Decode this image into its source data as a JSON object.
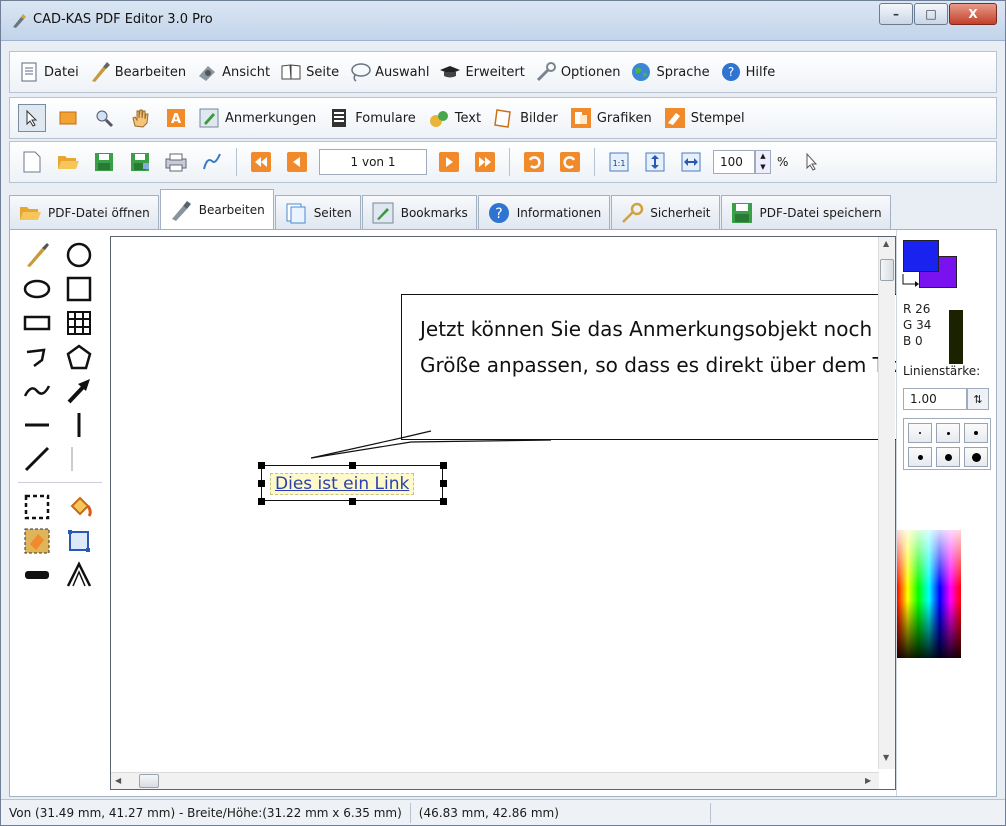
{
  "window": {
    "title": "CAD-KAS PDF Editor 3.0 Pro",
    "minimize": "–",
    "maximize": "□",
    "close": "X"
  },
  "menu": [
    {
      "label": "Datei",
      "icon": "document-icon"
    },
    {
      "label": "Bearbeiten",
      "icon": "brush-icon"
    },
    {
      "label": "Ansicht",
      "icon": "eye-icon"
    },
    {
      "label": "Seite",
      "icon": "book-icon"
    },
    {
      "label": "Auswahl",
      "icon": "lasso-icon"
    },
    {
      "label": "Erweitert",
      "icon": "graduation-cap-icon"
    },
    {
      "label": "Optionen",
      "icon": "wrench-icon"
    },
    {
      "label": "Sprache",
      "icon": "globe-icon"
    },
    {
      "label": "Hilfe",
      "icon": "help-icon"
    }
  ],
  "toolbar1": {
    "labels": [
      "Anmerkungen",
      "Fomulare",
      "Text",
      "Bilder",
      "Grafiken",
      "Stempel"
    ]
  },
  "toolbar2": {
    "page_display": "1 von 1",
    "zoom_value": "100",
    "zoom_unit": "%",
    "fit_label": "1:1"
  },
  "tabs": [
    {
      "label": "PDF-Datei öffnen",
      "icon": "folder-icon"
    },
    {
      "label": "Bearbeiten",
      "icon": "pen-icon"
    },
    {
      "label": "Seiten",
      "icon": "pages-icon"
    },
    {
      "label": "Bookmarks",
      "icon": "bookmark-icon"
    },
    {
      "label": "Informationen",
      "icon": "info-icon"
    },
    {
      "label": "Sicherheit",
      "icon": "key-icon"
    },
    {
      "label": "PDF-Datei speichern",
      "icon": "save-icon"
    }
  ],
  "canvas": {
    "callout_text": "Jetzt können Sie das Anmerkungsobjekt noch in der Größe anpassen, so dass es direkt über dem Text liegt.",
    "link_text": "Dies ist ein Link"
  },
  "right_panel": {
    "r": "R 26",
    "g": "G 34",
    "b": "B 0",
    "line_width_label": "Linienstärke:",
    "line_width_value": "1.00",
    "fg_color": "#1a22f0",
    "bg_color": "#7a12f0"
  },
  "status": {
    "selection": "Von (31.49 mm, 41.27 mm) - Breite/Höhe:(31.22 mm x 6.35 mm)",
    "cursor": "(46.83 mm, 42.86 mm)"
  }
}
